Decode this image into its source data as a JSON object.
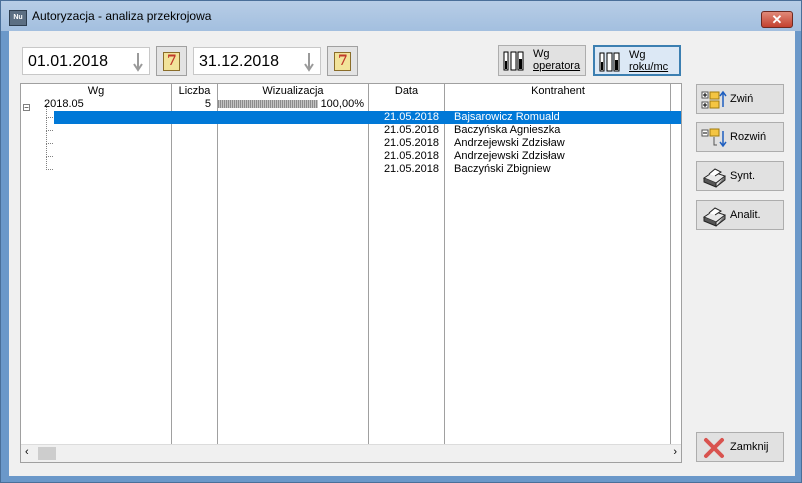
{
  "window": {
    "title": "Autoryzacja - analiza przekrojowa",
    "app_icon_text": "Nu",
    "close_label": "✕"
  },
  "toolbar": {
    "date_from": "01.01.2018",
    "date_to": "31.12.2018",
    "calendar_digit": "7",
    "btn_operator_line1": "Wg",
    "btn_operator_line2": "operatora",
    "btn_year_line1": "Wg",
    "btn_year_line2": "roku/mc"
  },
  "grid": {
    "columns": [
      "Wg",
      "Liczba",
      "Wizualizacja",
      "Data",
      "Kontrahent"
    ],
    "group": {
      "label": "2018.05",
      "count": "5",
      "percent": "100,00%",
      "percent_value": 100
    },
    "rows": [
      {
        "date": "21.05.2018",
        "contractor": "Bajsarowicz Romuald",
        "selected": true
      },
      {
        "date": "21.05.2018",
        "contractor": "Baczyńska Agnieszka",
        "selected": false
      },
      {
        "date": "21.05.2018",
        "contractor": "Andrzejewski Zdzisław",
        "selected": false
      },
      {
        "date": "21.05.2018",
        "contractor": "Andrzejewski Zdzisław",
        "selected": false
      },
      {
        "date": "21.05.2018",
        "contractor": "Baczyński Zbigniew",
        "selected": false
      }
    ]
  },
  "sidebar": {
    "collapse_label": "Zwiń",
    "expand_label": "Rozwiń",
    "synth_label": "Synt.",
    "anal_label": "Analit.",
    "close_label": "Zamknij"
  },
  "colors": {
    "selection": "#0078d7",
    "frame": "#6b98c9",
    "close_button": "#c4412f"
  }
}
